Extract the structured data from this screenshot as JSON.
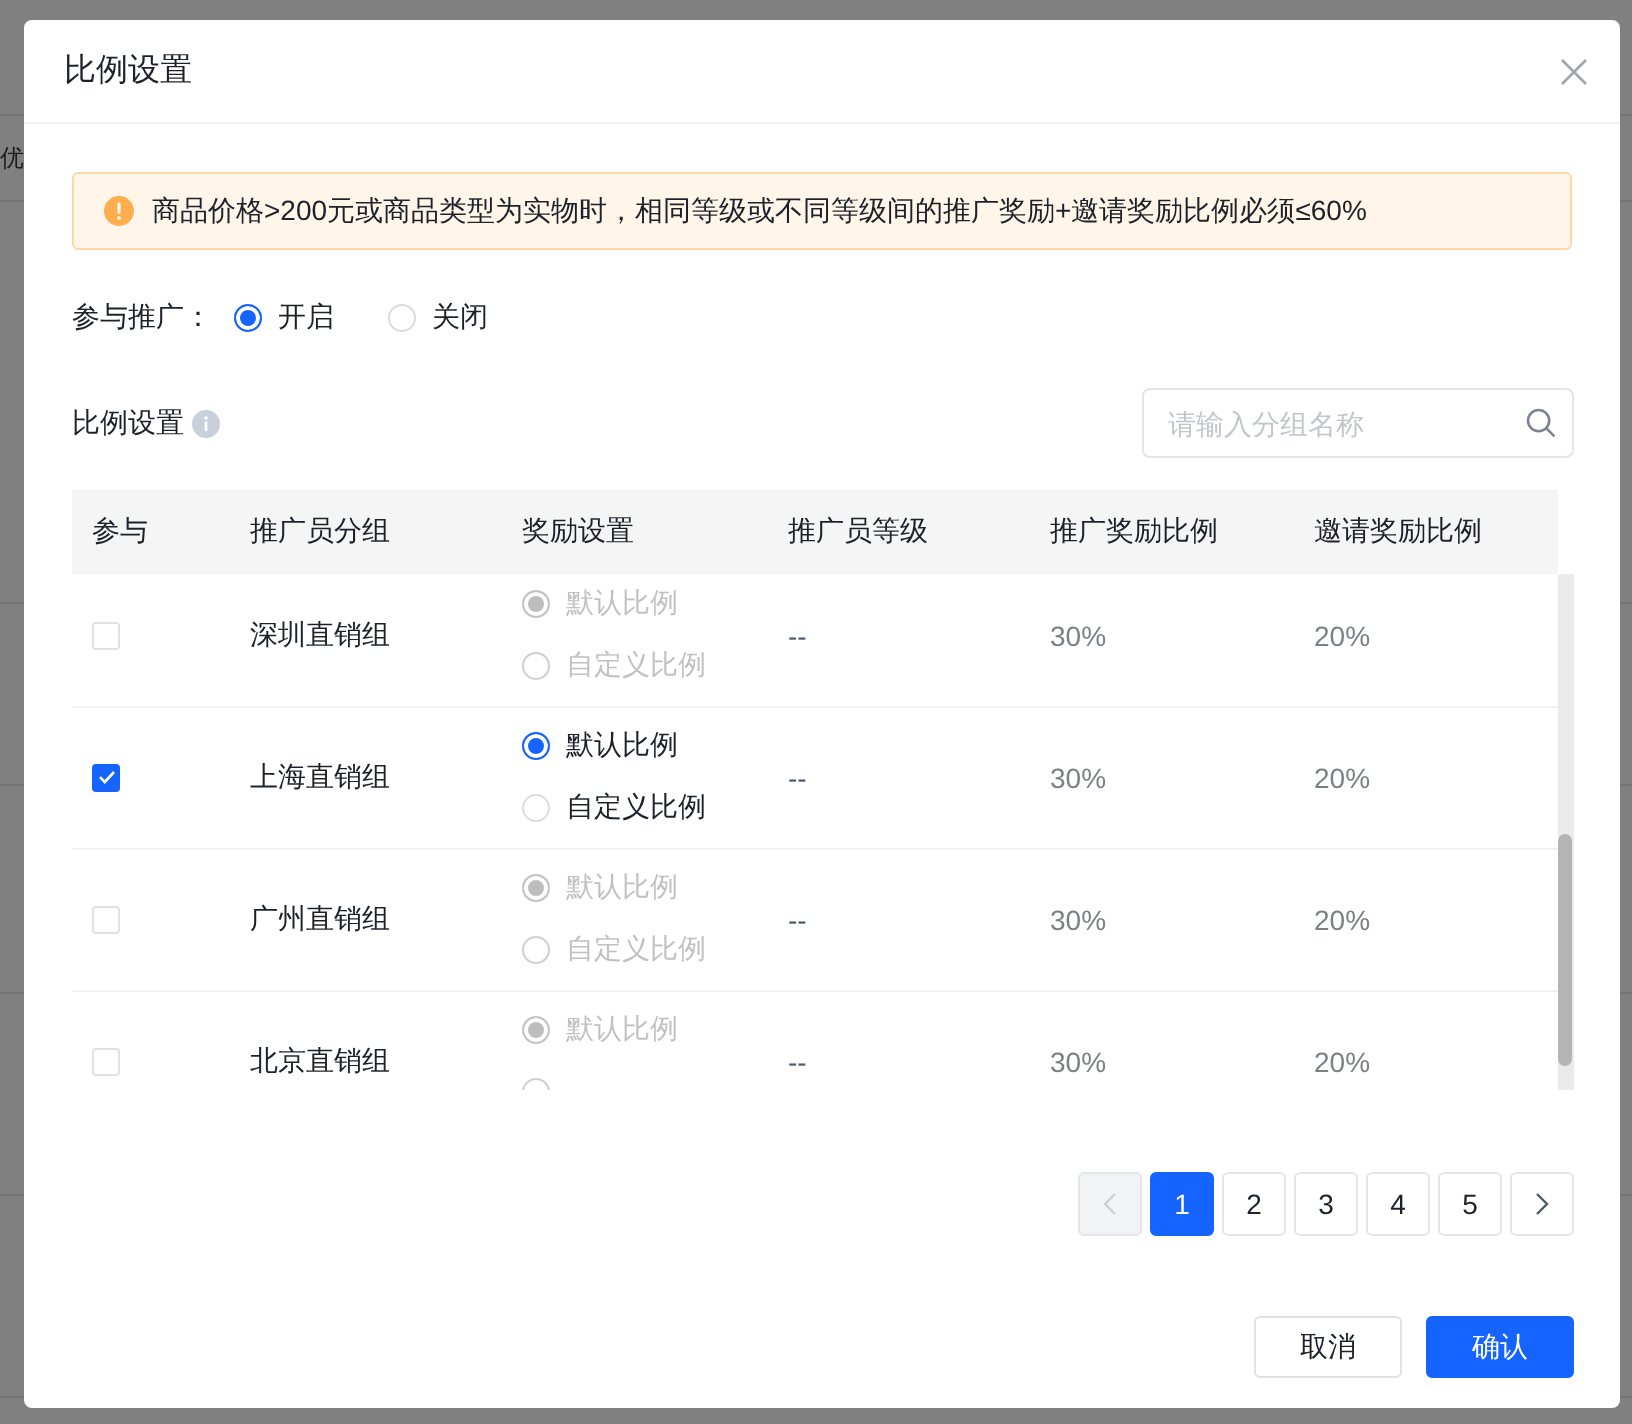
{
  "background": {
    "side_text": "优"
  },
  "dialog": {
    "title": "比例设置"
  },
  "alert": {
    "text": "商品价格>200元或商品类型为实物时，相同等级或不同等级间的推广奖励+邀请奖励比例必须≤60%"
  },
  "promotion": {
    "label": "参与推广：",
    "options": [
      {
        "label": "开启",
        "selected": true
      },
      {
        "label": "关闭",
        "selected": false
      }
    ]
  },
  "ratio_settings": {
    "label": "比例设置"
  },
  "search": {
    "placeholder": "请输入分组名称"
  },
  "table": {
    "columns": [
      "参与",
      "推广员分组",
      "奖励设置",
      "推广员等级",
      "推广奖励比例",
      "邀请奖励比例"
    ],
    "rows": [
      {
        "checked": false,
        "group": "深圳直销组",
        "reward_disabled": true,
        "reward_options": [
          {
            "label": "默认比例",
            "selected": true
          },
          {
            "label": "自定义比例",
            "selected": false
          }
        ],
        "level": "--",
        "promotion_ratio": "30%",
        "invite_ratio": "20%"
      },
      {
        "checked": true,
        "group": "上海直销组",
        "reward_disabled": false,
        "reward_options": [
          {
            "label": "默认比例",
            "selected": true
          },
          {
            "label": "自定义比例",
            "selected": false
          }
        ],
        "level": "--",
        "promotion_ratio": "30%",
        "invite_ratio": "20%"
      },
      {
        "checked": false,
        "group": "广州直销组",
        "reward_disabled": true,
        "reward_options": [
          {
            "label": "默认比例",
            "selected": true
          },
          {
            "label": "自定义比例",
            "selected": false
          }
        ],
        "level": "--",
        "promotion_ratio": "30%",
        "invite_ratio": "20%"
      },
      {
        "checked": false,
        "group": "北京直销组",
        "reward_disabled": true,
        "reward_options": [
          {
            "label": "默认比例",
            "selected": true
          },
          {
            "selected": false
          }
        ],
        "level": "--",
        "promotion_ratio": "30%",
        "invite_ratio": "20%"
      }
    ]
  },
  "pagination": {
    "previous": {
      "disabled": true
    },
    "pages": [
      {
        "label": "1",
        "selected": true
      },
      {
        "label": "2",
        "selected": false
      },
      {
        "label": "3",
        "selected": false
      },
      {
        "label": "4",
        "selected": false
      },
      {
        "label": "5",
        "selected": false
      }
    ],
    "next": {
      "disabled": false
    }
  },
  "buttons": [
    {
      "label": "取消",
      "kind": "secondary"
    },
    {
      "label": "确认",
      "kind": "primary"
    }
  ]
}
